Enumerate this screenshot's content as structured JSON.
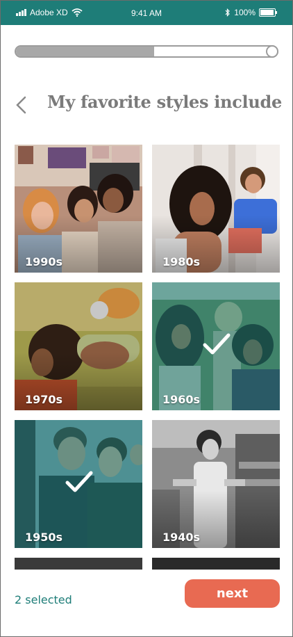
{
  "status_bar": {
    "carrier": "Adobe XD",
    "time": "9:41 AM",
    "battery": "100%",
    "background": "#1e7d78"
  },
  "progress": {
    "percent": 53
  },
  "header": {
    "title": "My favorite styles include",
    "back_icon": "chevron-left-icon"
  },
  "styles": [
    {
      "label": "1990s",
      "selected": false
    },
    {
      "label": "1980s",
      "selected": false
    },
    {
      "label": "1970s",
      "selected": false
    },
    {
      "label": "1960s",
      "selected": true
    },
    {
      "label": "1950s",
      "selected": true
    },
    {
      "label": "1940s",
      "selected": false
    }
  ],
  "footer": {
    "selected_text": "2 selected",
    "next_label": "next"
  },
  "colors": {
    "accent": "#1e7d78",
    "button": "#e86a52",
    "title": "#7a7a7a"
  }
}
